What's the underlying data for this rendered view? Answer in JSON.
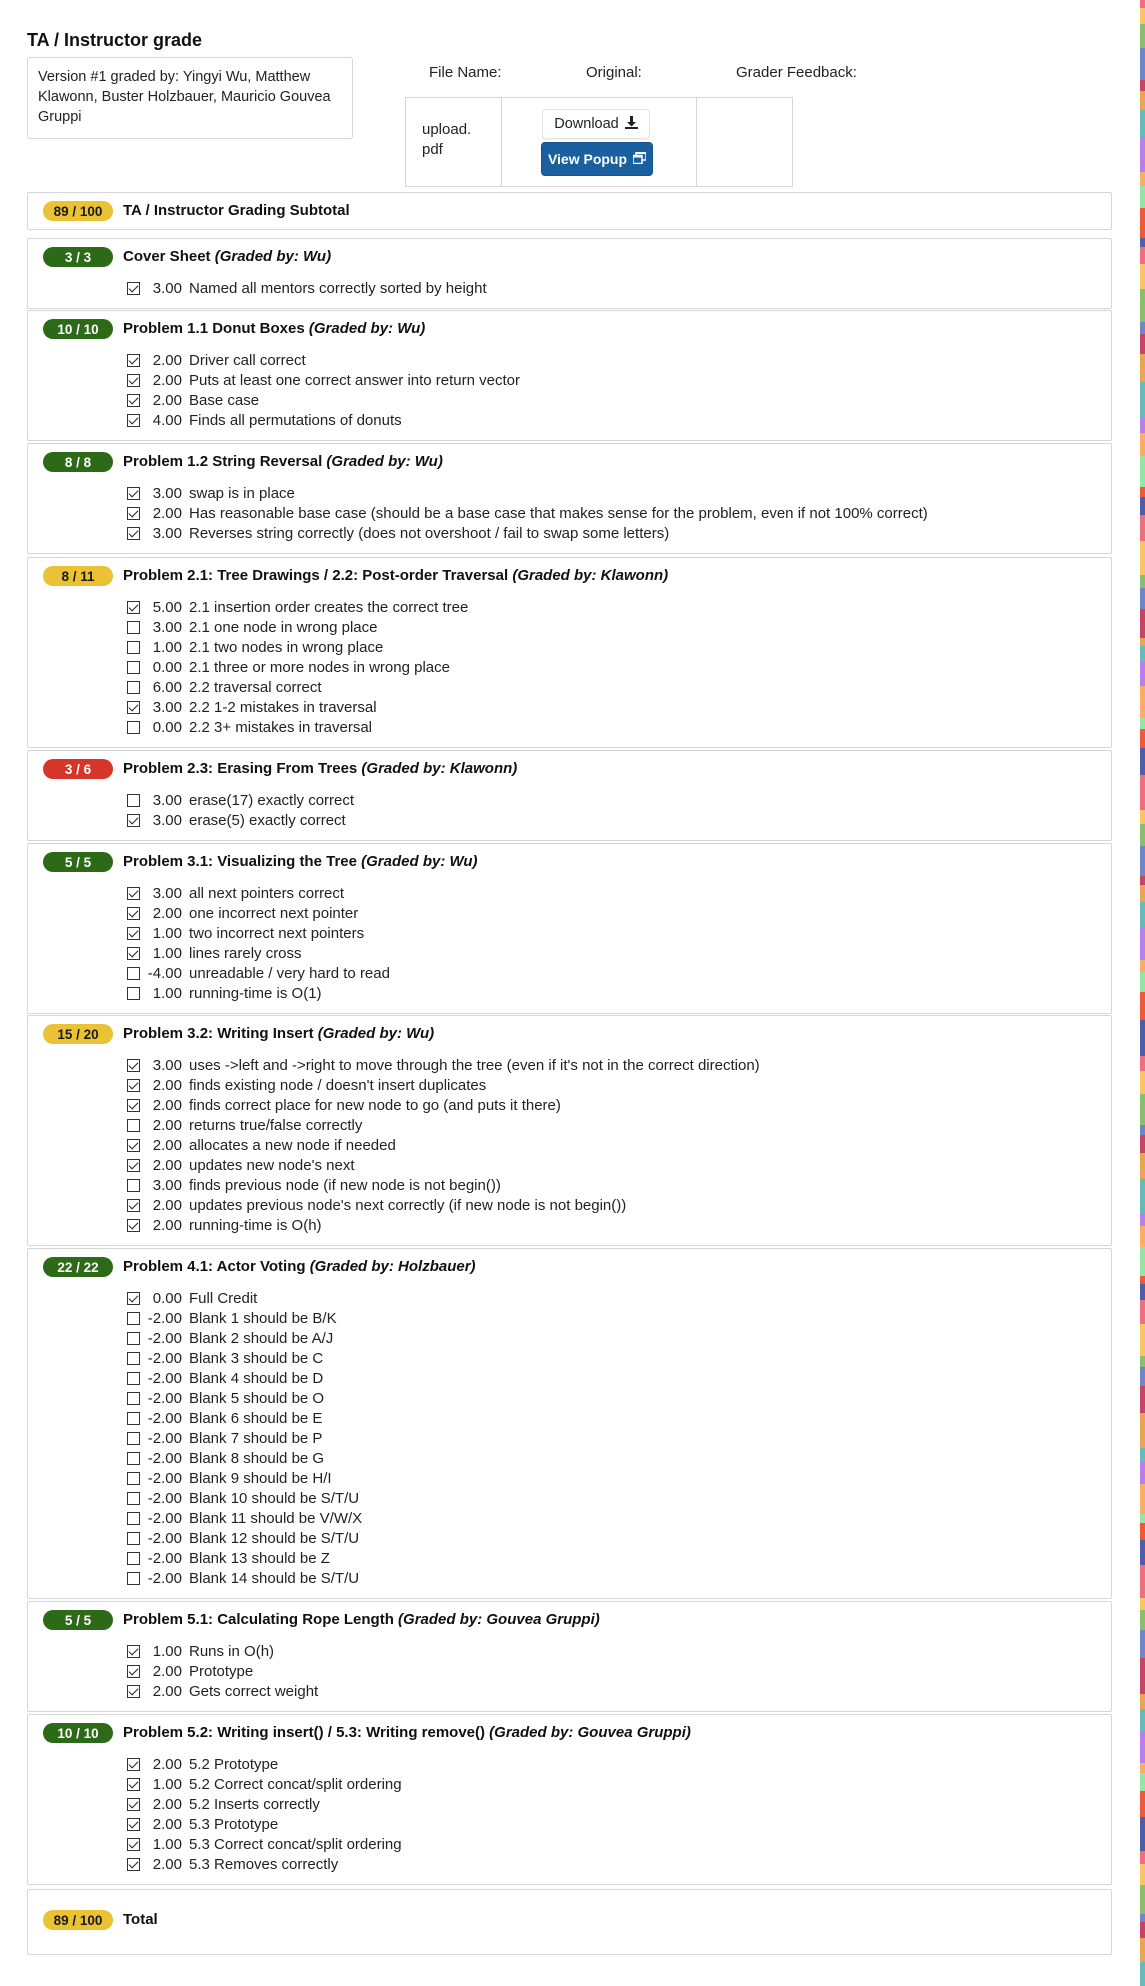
{
  "page_title": "TA / Instructor grade",
  "graded_by_text": "Version #1 graded by: Yingyi Wu, Matthew Klawonn, Buster Holzbauer, Mauricio Gouvea Gruppi",
  "file_table": {
    "headers": {
      "file_name": "File Name:",
      "original": "Original:",
      "feedback": "Grader Feedback:"
    },
    "file_name": "upload.\npdf",
    "download_label": "Download",
    "popup_label": "View Popup",
    "download_icon": "download-icon",
    "popup_icon": "popup-window-icon"
  },
  "colors": {
    "yellow": "#ebc233",
    "green": "#2c6a18",
    "red": "#d6352a",
    "blue_button": "#1a5f9e"
  },
  "subtotal": {
    "badge": "89 / 100",
    "badge_color": "yellow",
    "title": "TA / Instructor Grading Subtotal"
  },
  "sections": [
    {
      "badge": "3 / 3",
      "badge_color": "green",
      "title": "Cover Sheet ",
      "grader": "(Graded by: Wu)",
      "items": [
        {
          "checked": true,
          "points": "3.00",
          "label": "Named all mentors correctly sorted by height"
        }
      ]
    },
    {
      "badge": "10 / 10",
      "badge_color": "green",
      "title": "Problem 1.1 Donut Boxes ",
      "grader": "(Graded by: Wu)",
      "items": [
        {
          "checked": true,
          "points": "2.00",
          "label": "Driver call correct"
        },
        {
          "checked": true,
          "points": "2.00",
          "label": "Puts at least one correct answer into return vector"
        },
        {
          "checked": true,
          "points": "2.00",
          "label": "Base case"
        },
        {
          "checked": true,
          "points": "4.00",
          "label": "Finds all permutations of donuts"
        }
      ]
    },
    {
      "badge": "8 / 8",
      "badge_color": "green",
      "title": "Problem 1.2 String Reversal ",
      "grader": "(Graded by: Wu)",
      "items": [
        {
          "checked": true,
          "points": "3.00",
          "label": "swap is in place"
        },
        {
          "checked": true,
          "points": "2.00",
          "label": "Has reasonable base case (should be a base case that makes sense for the problem, even if not 100% correct)"
        },
        {
          "checked": true,
          "points": "3.00",
          "label": "Reverses string correctly (does not overshoot / fail to swap some letters)"
        }
      ]
    },
    {
      "badge": "8 / 11",
      "badge_color": "yellow",
      "title": "Problem 2.1: Tree Drawings / 2.2: Post-order Traversal ",
      "grader": "(Graded by: Klawonn)",
      "items": [
        {
          "checked": true,
          "points": "5.00",
          "label": "2.1 insertion order creates the correct tree"
        },
        {
          "checked": false,
          "points": "3.00",
          "label": "2.1 one node in wrong place"
        },
        {
          "checked": false,
          "points": "1.00",
          "label": "2.1 two nodes in wrong place"
        },
        {
          "checked": false,
          "points": "0.00",
          "label": "2.1 three or more nodes in wrong place"
        },
        {
          "checked": false,
          "points": "6.00",
          "label": "2.2 traversal correct"
        },
        {
          "checked": true,
          "points": "3.00",
          "label": "2.2 1-2 mistakes in traversal"
        },
        {
          "checked": false,
          "points": "0.00",
          "label": "2.2 3+ mistakes in traversal"
        }
      ]
    },
    {
      "badge": "3 / 6",
      "badge_color": "red",
      "title": "Problem 2.3: Erasing From Trees ",
      "grader": "(Graded by: Klawonn)",
      "items": [
        {
          "checked": false,
          "points": "3.00",
          "label": "erase(17) exactly correct"
        },
        {
          "checked": true,
          "points": "3.00",
          "label": "erase(5) exactly correct"
        }
      ]
    },
    {
      "badge": "5 / 5",
      "badge_color": "green",
      "title": "Problem 3.1: Visualizing the Tree ",
      "grader": "(Graded by: Wu)",
      "items": [
        {
          "checked": true,
          "points": "3.00",
          "label": "all next pointers correct"
        },
        {
          "checked": true,
          "points": "2.00",
          "label": "one incorrect next pointer"
        },
        {
          "checked": true,
          "points": "1.00",
          "label": "two incorrect next pointers"
        },
        {
          "checked": true,
          "points": "1.00",
          "label": "lines rarely cross"
        },
        {
          "checked": false,
          "points": "-4.00",
          "label": "unreadable / very hard to read"
        },
        {
          "checked": false,
          "points": "1.00",
          "label": "running-time is O(1)"
        }
      ]
    },
    {
      "badge": "15 / 20",
      "badge_color": "yellow",
      "title": "Problem 3.2: Writing Insert ",
      "grader": "(Graded by: Wu)",
      "items": [
        {
          "checked": true,
          "points": "3.00",
          "label": "uses ->left and ->right to move through the tree (even if it's not in the correct direction)"
        },
        {
          "checked": true,
          "points": "2.00",
          "label": "finds existing node / doesn't insert duplicates"
        },
        {
          "checked": true,
          "points": "2.00",
          "label": "finds correct place for new node to go (and puts it there)"
        },
        {
          "checked": false,
          "points": "2.00",
          "label": "returns true/false correctly"
        },
        {
          "checked": true,
          "points": "2.00",
          "label": "allocates a new node if needed"
        },
        {
          "checked": true,
          "points": "2.00",
          "label": "updates new node's next"
        },
        {
          "checked": false,
          "points": "3.00",
          "label": "finds previous node (if new node is not begin())"
        },
        {
          "checked": true,
          "points": "2.00",
          "label": "updates previous node's next correctly (if new node is not begin())"
        },
        {
          "checked": true,
          "points": "2.00",
          "label": "running-time is O(h)"
        }
      ]
    },
    {
      "badge": "22 / 22",
      "badge_color": "green",
      "title": "Problem 4.1: Actor Voting ",
      "grader": "(Graded by: Holzbauer)",
      "items": [
        {
          "checked": true,
          "points": "0.00",
          "label": "Full Credit"
        },
        {
          "checked": false,
          "points": "-2.00",
          "label": "Blank 1 should be B/K"
        },
        {
          "checked": false,
          "points": "-2.00",
          "label": "Blank 2 should be A/J"
        },
        {
          "checked": false,
          "points": "-2.00",
          "label": "Blank 3 should be C"
        },
        {
          "checked": false,
          "points": "-2.00",
          "label": "Blank 4 should be D"
        },
        {
          "checked": false,
          "points": "-2.00",
          "label": "Blank 5 should be O"
        },
        {
          "checked": false,
          "points": "-2.00",
          "label": "Blank 6 should be E"
        },
        {
          "checked": false,
          "points": "-2.00",
          "label": "Blank 7 should be P"
        },
        {
          "checked": false,
          "points": "-2.00",
          "label": "Blank 8 should be G"
        },
        {
          "checked": false,
          "points": "-2.00",
          "label": "Blank 9 should be H/I"
        },
        {
          "checked": false,
          "points": "-2.00",
          "label": "Blank 10 should be S/T/U"
        },
        {
          "checked": false,
          "points": "-2.00",
          "label": "Blank 11 should be V/W/X"
        },
        {
          "checked": false,
          "points": "-2.00",
          "label": "Blank 12 should be S/T/U"
        },
        {
          "checked": false,
          "points": "-2.00",
          "label": "Blank 13 should be Z"
        },
        {
          "checked": false,
          "points": "-2.00",
          "label": "Blank 14 should be S/T/U"
        }
      ]
    },
    {
      "badge": "5 / 5",
      "badge_color": "green",
      "title": "Problem 5.1: Calculating Rope Length ",
      "grader": "(Graded by: Gouvea Gruppi)",
      "items": [
        {
          "checked": true,
          "points": "1.00",
          "label": "Runs in O(h)"
        },
        {
          "checked": true,
          "points": "2.00",
          "label": "Prototype"
        },
        {
          "checked": true,
          "points": "2.00",
          "label": "Gets correct weight"
        }
      ]
    },
    {
      "badge": "10 / 10",
      "badge_color": "green",
      "title": "Problem 5.2: Writing insert() / 5.3: Writing remove() ",
      "grader": "(Graded by: Gouvea Gruppi)",
      "items": [
        {
          "checked": true,
          "points": "2.00",
          "label": "5.2 Prototype"
        },
        {
          "checked": true,
          "points": "1.00",
          "label": "5.2 Correct concat/split ordering"
        },
        {
          "checked": true,
          "points": "2.00",
          "label": "5.2 Inserts correctly"
        },
        {
          "checked": true,
          "points": "2.00",
          "label": "5.3 Prototype"
        },
        {
          "checked": true,
          "points": "1.00",
          "label": "5.3 Correct concat/split ordering"
        },
        {
          "checked": true,
          "points": "2.00",
          "label": "5.3 Removes correctly"
        }
      ]
    }
  ],
  "total": {
    "badge": "89 / 100",
    "badge_color": "yellow",
    "title": "Total"
  }
}
